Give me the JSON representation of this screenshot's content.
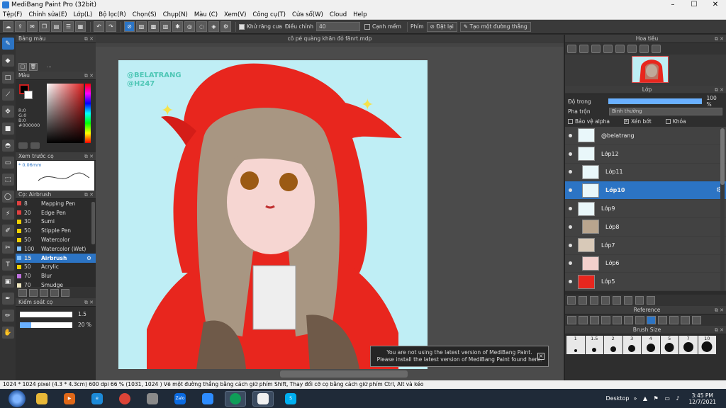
{
  "window": {
    "title": "MediBang Paint Pro (32bit)"
  },
  "menu": [
    "Tệp(F)",
    "Chỉnh sửa(E)",
    "Lớp(L)",
    "Bộ lọc(R)",
    "Chọn(S)",
    "Chụp(N)",
    "Màu (C)",
    "Xem(V)",
    "Công cụ(T)",
    "Cửa sổ(W)",
    "Cloud",
    "Help"
  ],
  "toolbar": {
    "antialias_label": "Khử răng cưa",
    "adjust_label": "Điều chỉnh",
    "adjust_value": "40",
    "smooth_label": "Cạnh mềm",
    "key_label": "Phím",
    "reset_label": "Đặt lại",
    "line_label": "Tạo một đường thẳng"
  },
  "panels": {
    "palette_title": "Bảng màu",
    "palette_dots": "···",
    "color_title": "Màu",
    "rgb": [
      "R:0",
      "G:0",
      "B:0",
      "#000000"
    ],
    "preview_title": "Xem trước cọ",
    "preview_size": "* 0.06mm",
    "brush_title": "Cọ: Airbrush",
    "brushes": [
      {
        "num": "8",
        "name": "Mapping Pen",
        "color": "#e04040"
      },
      {
        "num": "20",
        "name": "Edge Pen",
        "color": "#e04040"
      },
      {
        "num": "30",
        "name": "Sumi",
        "color": "#f0d000"
      },
      {
        "num": "50",
        "name": "Stipple Pen",
        "color": "#f0d000"
      },
      {
        "num": "50",
        "name": "Watercolor",
        "color": "#f0d000"
      },
      {
        "num": "100",
        "name": "Watercolor (Wet)",
        "color": "#80c0ff"
      },
      {
        "num": "15",
        "name": "Airbrush",
        "color": "#80c0ff",
        "active": true
      },
      {
        "num": "50",
        "name": "Acrylic",
        "color": "#f0d000"
      },
      {
        "num": "70",
        "name": "Blur",
        "color": "#c070e0"
      },
      {
        "num": "70",
        "name": "Smudge",
        "color": "#f0e8c0"
      }
    ],
    "control_title": "Kiểm soát cọ",
    "control_size": "1.5",
    "control_opacity": "20 %"
  },
  "canvas": {
    "doc_title": "cô pé quàng khăn đỏ fănrt.mdp",
    "watermark_line1": "@BELATRANG",
    "watermark_line2": "@H247"
  },
  "notification": {
    "line1": "You are not using the latest version of MediBang Paint.",
    "line2": "Please install the latest version of MediBang Paint found here.",
    "close": "×"
  },
  "right": {
    "navigator_title": "Hoa tiêu",
    "layer_title": "Lớp",
    "opacity_label": "Độ trong",
    "opacity_value": "100 %",
    "blend_label": "Pha trộn",
    "blend_value": "Bình thường",
    "check_alpha": "Bảo vệ alpha",
    "check_clip": "Xén bớt",
    "check_lock": "Khóa",
    "layers": [
      {
        "name": "@belatrang",
        "clip": false,
        "active": false
      },
      {
        "name": "Lớp12",
        "clip": false,
        "active": false
      },
      {
        "name": "Lớp11",
        "clip": true,
        "active": false
      },
      {
        "name": "Lớp10",
        "clip": true,
        "active": true
      },
      {
        "name": "Lớp9",
        "clip": false,
        "active": false
      },
      {
        "name": "Lớp8",
        "clip": true,
        "active": false
      },
      {
        "name": "Lớp7",
        "clip": false,
        "active": false
      },
      {
        "name": "Lớp6",
        "clip": true,
        "active": false
      },
      {
        "name": "Lớp5",
        "clip": false,
        "active": false
      }
    ],
    "reference_title": "Reference",
    "brushsize_title": "Brush Size",
    "brush_sizes": [
      "1",
      "1.5",
      "2",
      "3",
      "4",
      "5",
      "7",
      "10"
    ]
  },
  "status": {
    "text": "1024 * 1024 pixel  (4.3 * 4.3cm)  600 dpi  66 %  (1031, 1024 )  Vẽ một đường thẳng bằng cách giữ phím Shift, Thay đổi cỡ cọ bằng cách giữ phím Ctrl, Alt và kéo"
  },
  "taskbar": {
    "desktop_label": "Desktop",
    "time": "3:45 PM",
    "date": "12/7/2021",
    "apps": [
      "file-explorer",
      "media-player",
      "internet-explorer",
      "chrome",
      "paint-tool",
      "zalo",
      "zoom",
      "chrome-2",
      "medibang",
      "skype"
    ]
  }
}
